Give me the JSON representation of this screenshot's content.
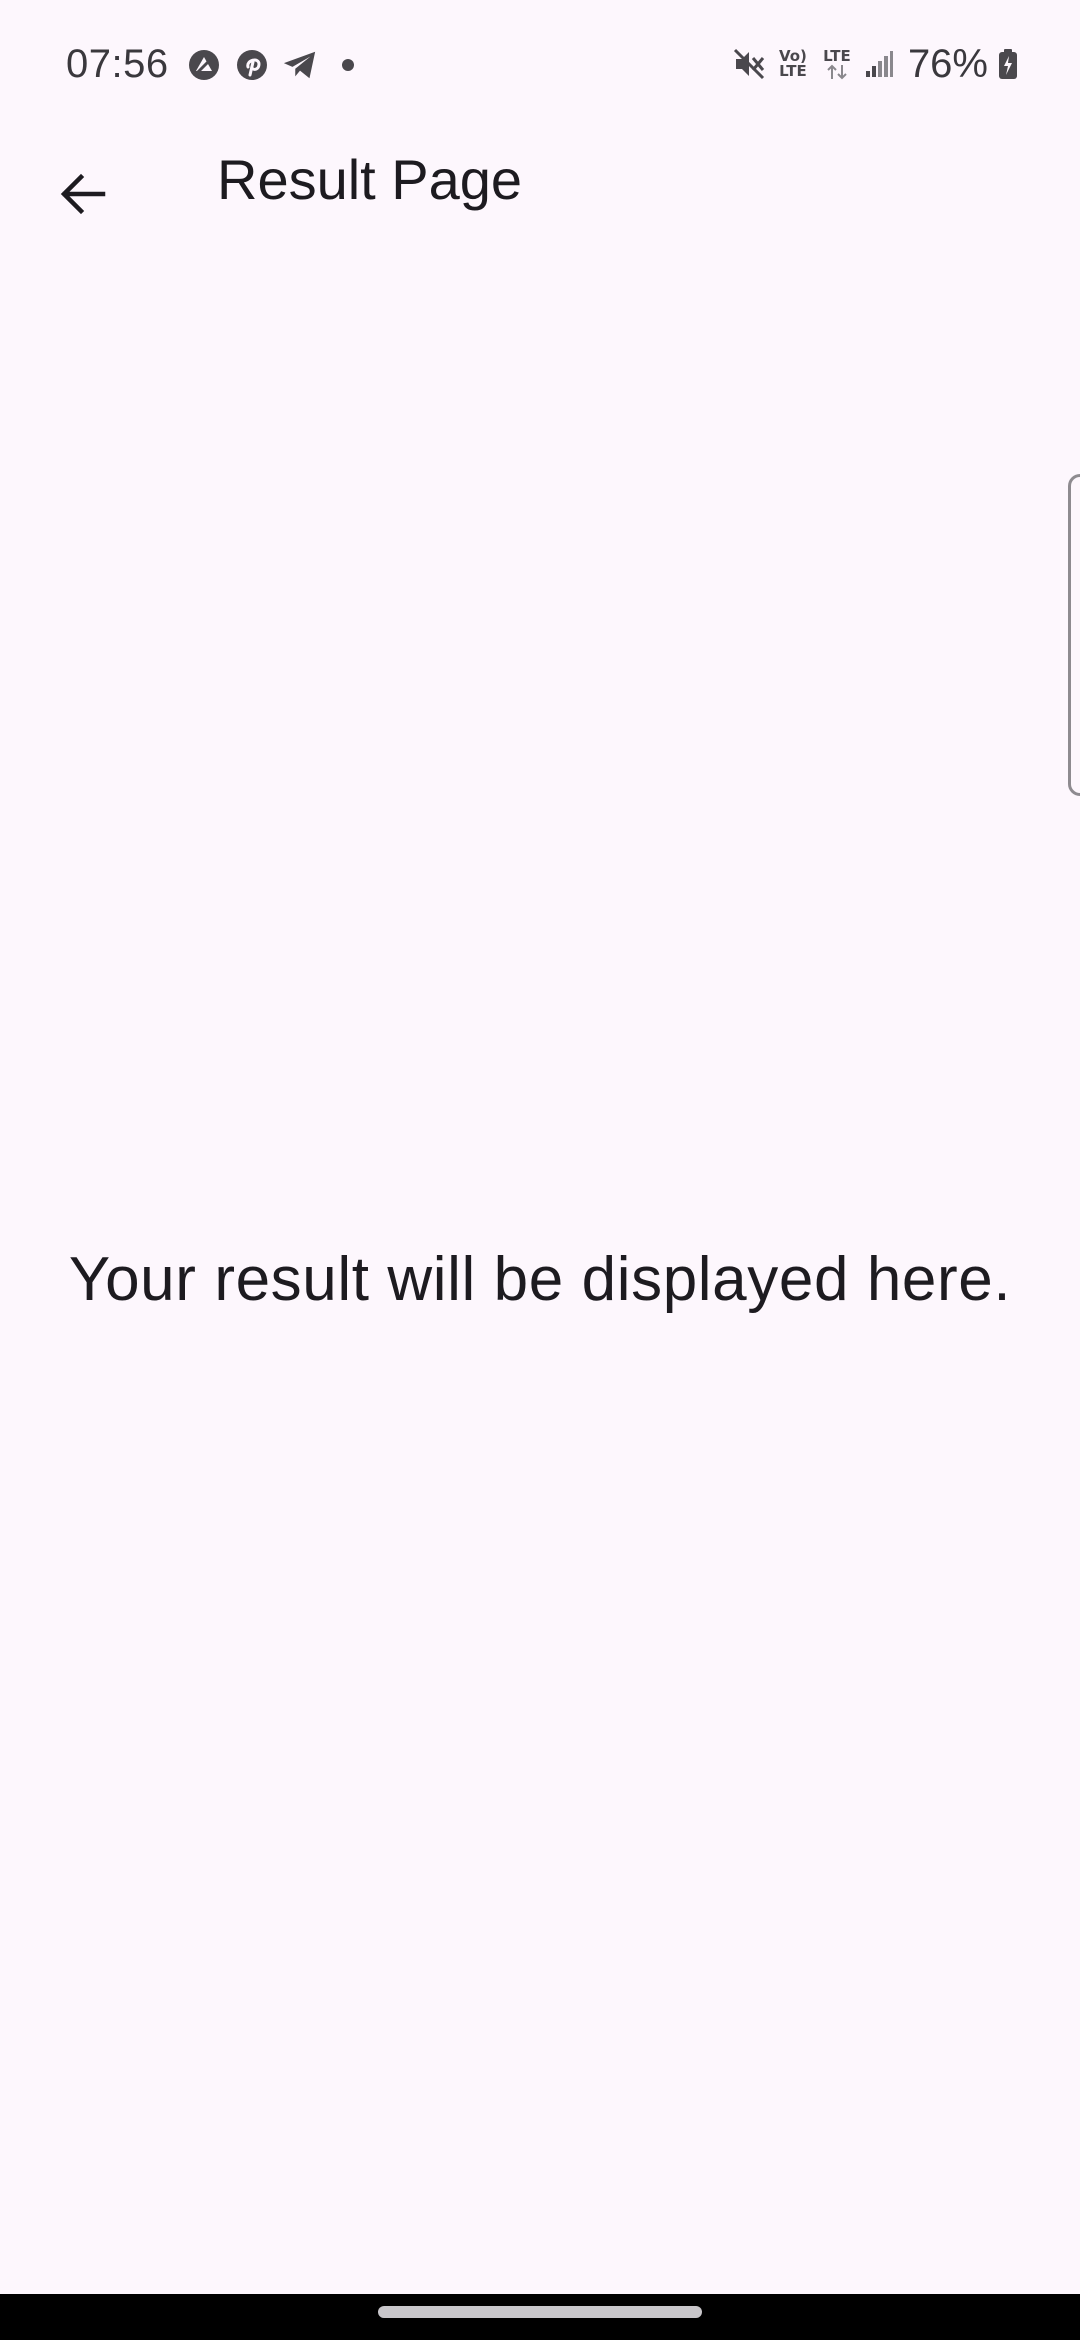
{
  "status_bar": {
    "time": "07:56",
    "left_icons": [
      "signal-app-icon",
      "pinterest-icon",
      "telegram-icon",
      "notification-dot-icon"
    ],
    "right_icons": [
      "mute-icon",
      "volte-icon",
      "lte-data-icon",
      "signal-strength-icon",
      "battery-charging-icon"
    ],
    "volte_line1": "Vo)",
    "volte_line2": "LTE",
    "lte_label": "LTE",
    "battery_percent": "76%"
  },
  "app_bar": {
    "back_icon": "arrow-left-icon",
    "title": "Result Page"
  },
  "main": {
    "message": "Your result will be displayed here."
  },
  "colors": {
    "background": "#fdf7fd",
    "text": "#1d1b20",
    "nav_bar": "#000000"
  }
}
